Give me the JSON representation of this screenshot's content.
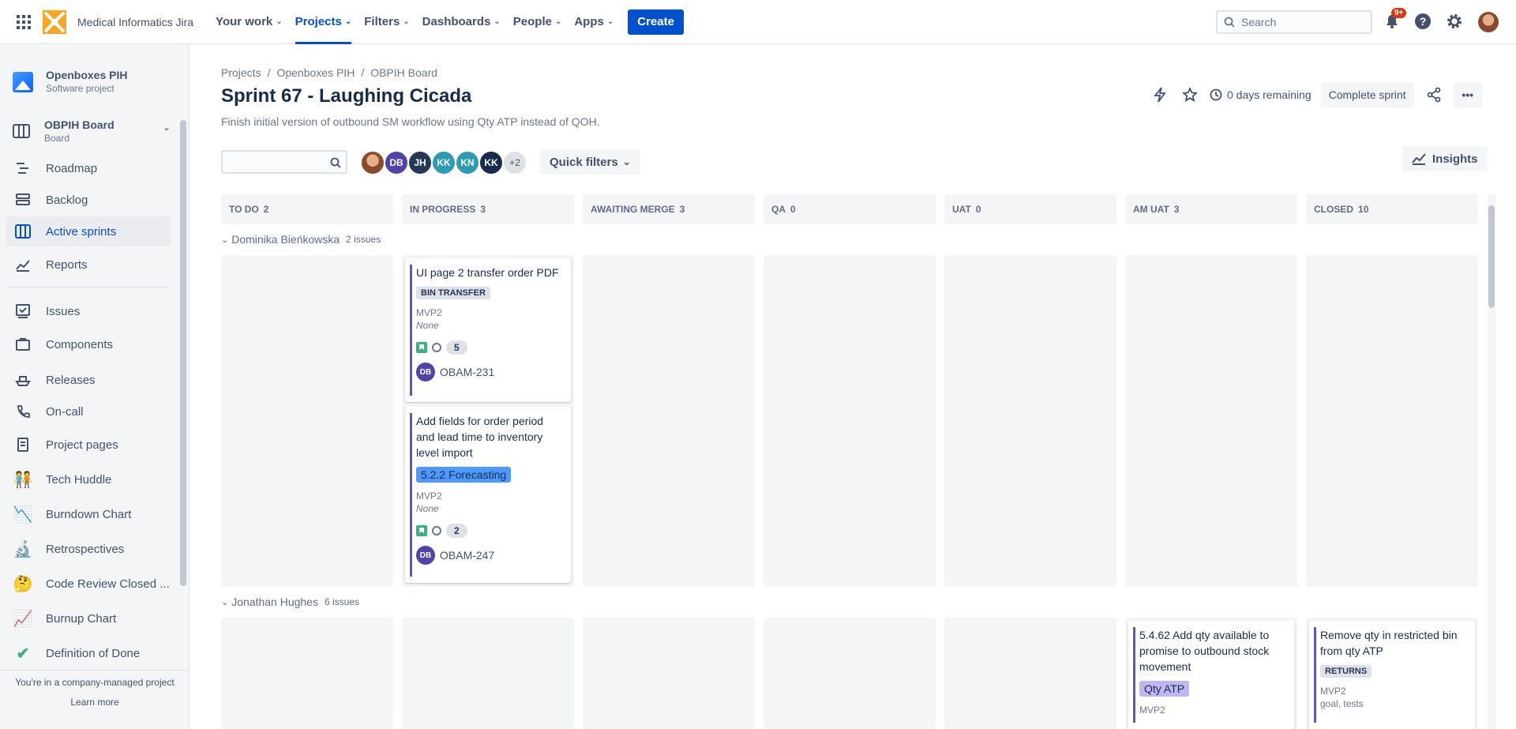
{
  "topnav": {
    "site_name": "Medical Informatics Jira",
    "items": [
      {
        "label": "Your work"
      },
      {
        "label": "Projects"
      },
      {
        "label": "Filters"
      },
      {
        "label": "Dashboards"
      },
      {
        "label": "People"
      },
      {
        "label": "Apps"
      }
    ],
    "create_label": "Create",
    "search_placeholder": "Search",
    "notifications_badge": "9+"
  },
  "sidebar": {
    "project_name": "Openboxes PIH",
    "project_type": "Software project",
    "board_name": "OBPIH Board",
    "board_type": "Board",
    "items": [
      {
        "label": "Roadmap",
        "icon": "roadmap-icon"
      },
      {
        "label": "Backlog",
        "icon": "backlog-icon"
      },
      {
        "label": "Active sprints",
        "icon": "board-icon"
      },
      {
        "label": "Reports",
        "icon": "reports-icon"
      },
      {
        "label": "Issues",
        "icon": "issues-icon"
      },
      {
        "label": "Components",
        "icon": "components-icon"
      },
      {
        "label": "Releases",
        "icon": "ship-icon"
      },
      {
        "label": "On-call",
        "icon": "phone-icon"
      },
      {
        "label": "Project pages",
        "icon": "page-icon"
      },
      {
        "label": "Tech Huddle",
        "icon": "people-emoji-icon"
      },
      {
        "label": "Burndown Chart",
        "icon": "chart-down-icon"
      },
      {
        "label": "Retrospectives",
        "icon": "microscope-icon"
      },
      {
        "label": "Code Review Closed ...",
        "icon": "thinking-emoji-icon"
      },
      {
        "label": "Burnup Chart",
        "icon": "chart-up-icon"
      },
      {
        "label": "Definition of Done",
        "icon": "checkmark-icon"
      }
    ],
    "footer_text": "You're in a company-managed project",
    "learn_more": "Learn more"
  },
  "breadcrumb": [
    "Projects",
    "Openboxes PIH",
    "OBPIH Board"
  ],
  "sprint": {
    "title": "Sprint 67 - Laughing Cicada",
    "goal": "Finish initial version of outbound SM workflow using Qty ATP instead of QOH.",
    "days_remaining": "0 days remaining",
    "complete_label": "Complete sprint"
  },
  "filters": {
    "avatars": [
      {
        "initials": "",
        "color": "#a0522d"
      },
      {
        "initials": "DB",
        "color": "#5243aa"
      },
      {
        "initials": "JH",
        "color": "#253858"
      },
      {
        "initials": "KK",
        "color": "#2e9bb5"
      },
      {
        "initials": "KN",
        "color": "#2e9bb5"
      },
      {
        "initials": "KK",
        "color": "#172b4d"
      },
      {
        "initials": "+2",
        "color": "#dfe1e6"
      }
    ],
    "quick_filters_label": "Quick filters",
    "insights_label": "Insights"
  },
  "columns": [
    {
      "name": "TO DO",
      "count": "2"
    },
    {
      "name": "IN PROGRESS",
      "count": "3"
    },
    {
      "name": "AWAITING MERGE",
      "count": "3"
    },
    {
      "name": "QA",
      "count": "0"
    },
    {
      "name": "UAT",
      "count": "0"
    },
    {
      "name": "AM UAT",
      "count": "3"
    },
    {
      "name": "CLOSED",
      "count": "10"
    }
  ],
  "swimlanes": [
    {
      "name": "Dominika Bieńkowska",
      "count": "2 issues"
    },
    {
      "name": "Jonathan Hughes",
      "count": "6 issues"
    }
  ],
  "cards": [
    {
      "title": "UI page 2 transfer order PDF",
      "label": "BIN TRANSFER",
      "fix": "MVP2",
      "sub": "None",
      "points": "5",
      "assignee": "DB",
      "key": "OBAM-231"
    },
    {
      "title": "Add fields for order period and lead time to inventory level import",
      "label": "5.2.2 Forecasting",
      "fix": "MVP2",
      "sub": "None",
      "points": "2",
      "assignee": "DB",
      "key": "OBAM-247"
    },
    {
      "title": "5.4.62 Add qty available to promise to outbound stock movement",
      "label": "Qty ATP",
      "fix": "MVP2"
    },
    {
      "title": "Remove qty in restricted bin from qty ATP",
      "label": "RETURNS",
      "fix": "MVP2",
      "sub": "goal, tests"
    }
  ]
}
